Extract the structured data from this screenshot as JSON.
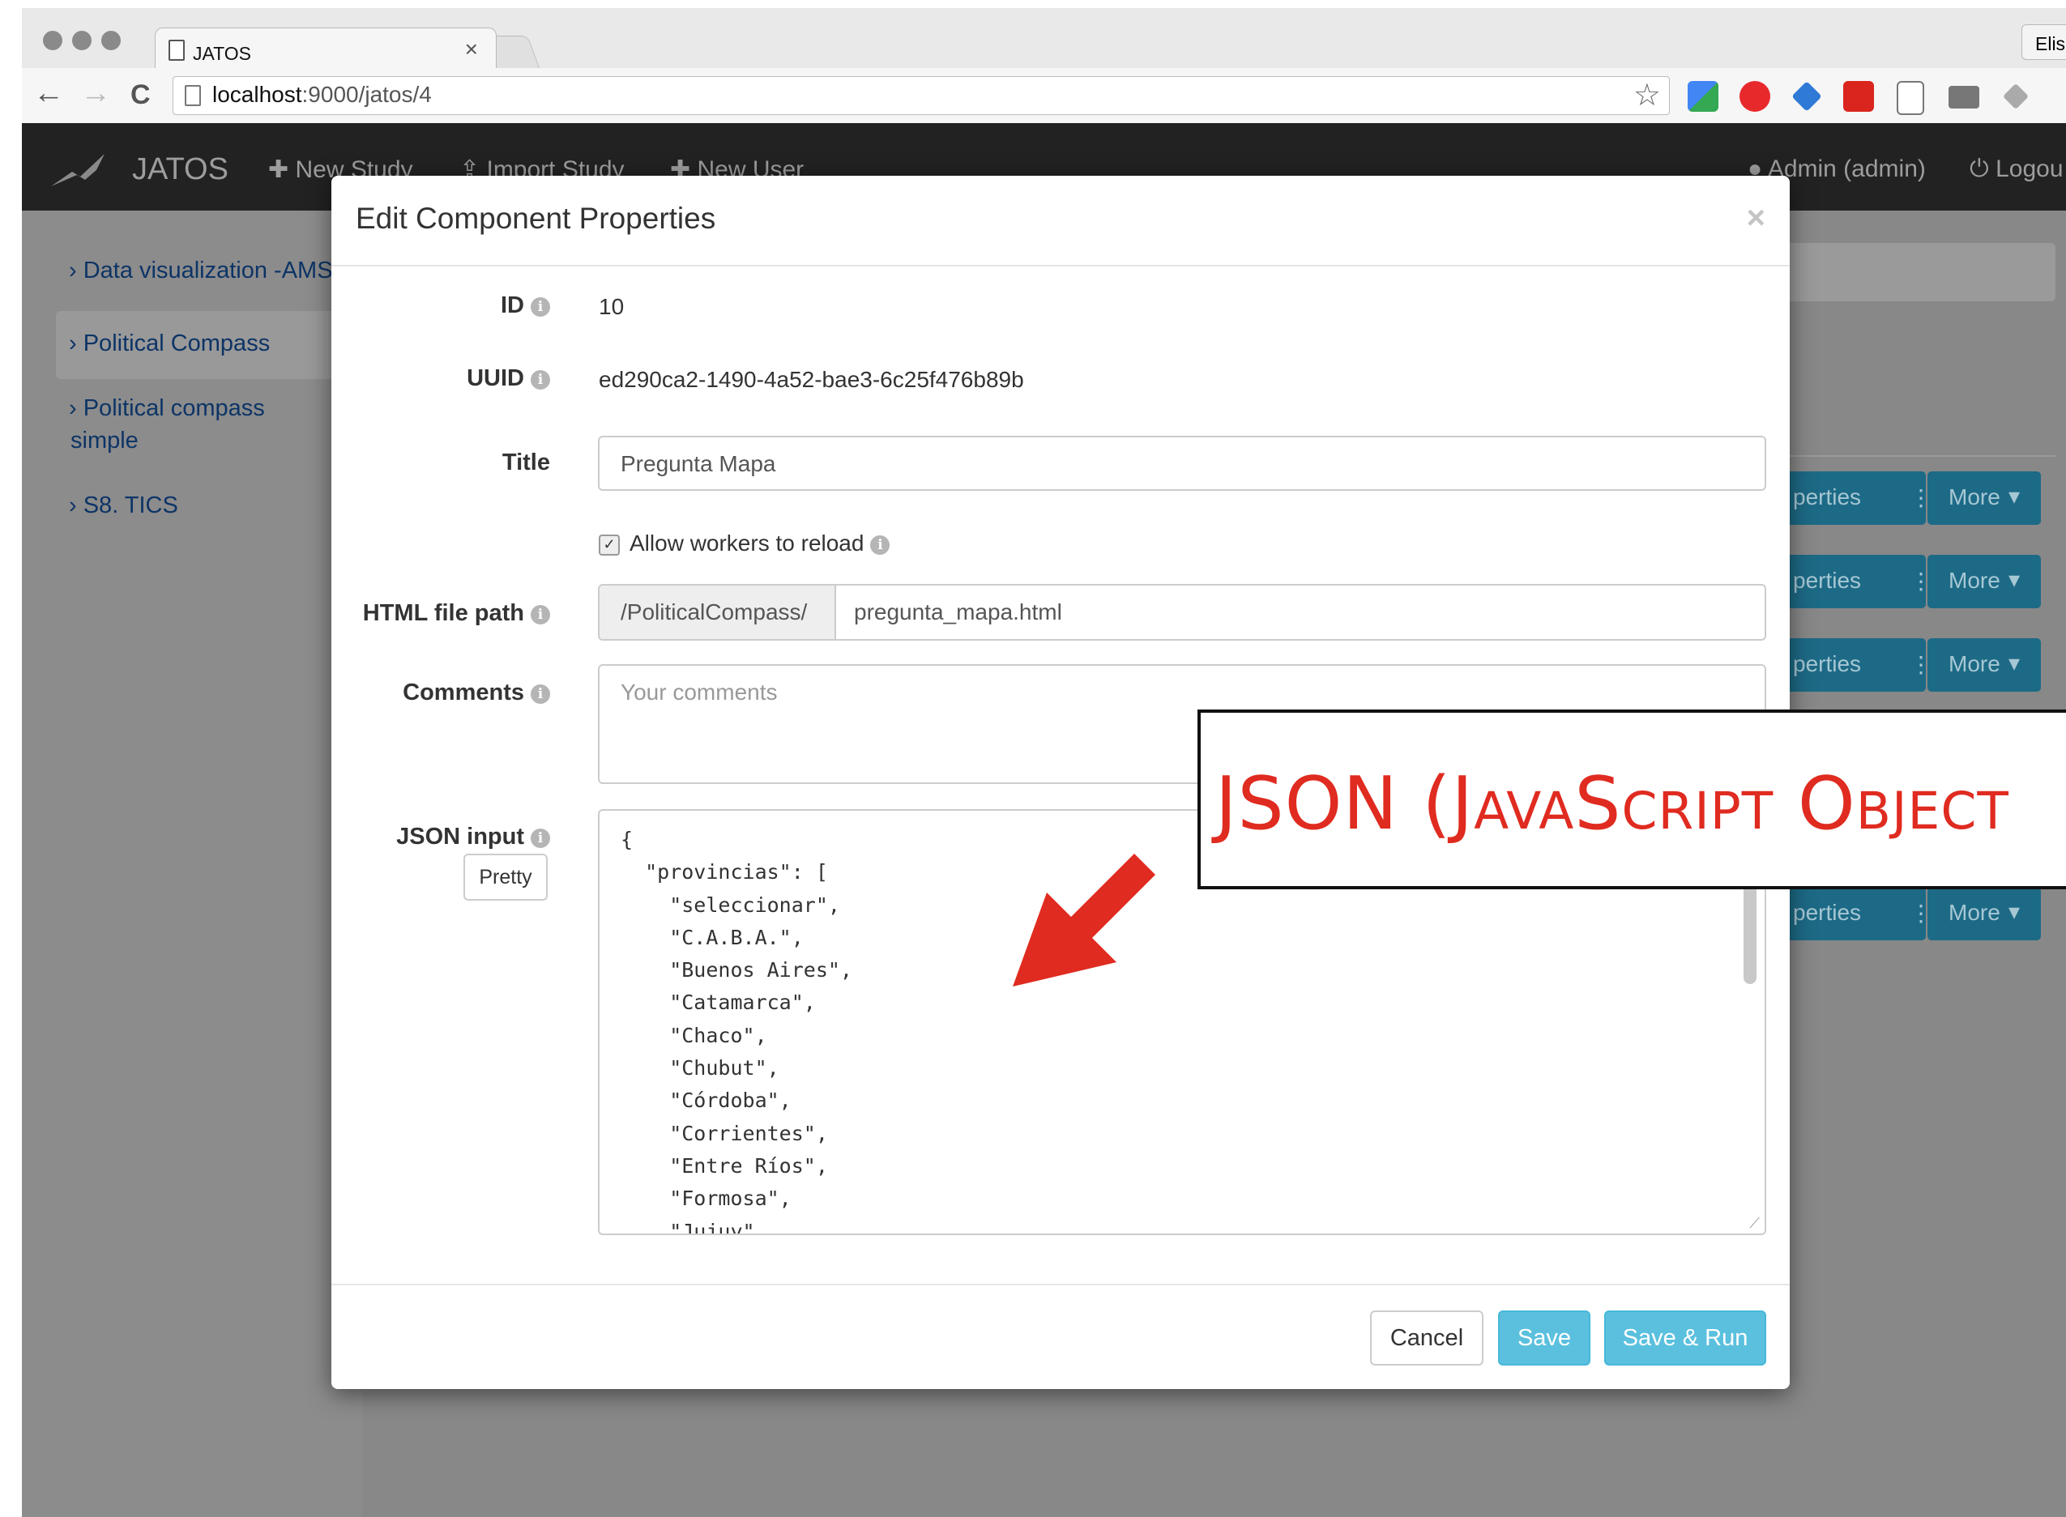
{
  "browser": {
    "tab_title": "JATOS",
    "tab_close": "×",
    "profile": "Elis",
    "url_host": "localhost",
    "url_path": ":9000/jatos/4",
    "nav_back": "←",
    "nav_forward": "→",
    "nav_reload": "C",
    "star": "☆"
  },
  "navbar": {
    "brand": "JATOS",
    "new_study": "New Study",
    "import_study": "Import Study",
    "new_user": "New User",
    "user": "Admin (admin)",
    "logout": "Logou"
  },
  "sidebar": {
    "items": [
      {
        "label": "Data visualization -AMS"
      },
      {
        "label": "Political Compass"
      },
      {
        "label": "Political compass"
      },
      {
        "label": "simple"
      },
      {
        "label": "S8. TICS"
      }
    ]
  },
  "background_rows": {
    "properties_label": "perties",
    "more_label": "More"
  },
  "modal": {
    "title": "Edit Component Properties",
    "close": "×",
    "id_label": "ID",
    "id_value": "10",
    "uuid_label": "UUID",
    "uuid_value": "ed290ca2-1490-4a52-bae3-6c25f476b89b",
    "title_label": "Title",
    "title_value": "Pregunta Mapa",
    "reload_label": "Allow workers to reload",
    "reload_checked": true,
    "html_path_label": "HTML file path",
    "html_path_prefix": "/PoliticalCompass/",
    "html_path_value": "pregunta_mapa.html",
    "comments_label": "Comments",
    "comments_placeholder": "Your comments",
    "json_label": "JSON input",
    "pretty_button": "Pretty",
    "json_text": "{\n  \"provincias\": [\n    \"seleccionar\",\n    \"C.A.B.A.\",\n    \"Buenos Aires\",\n    \"Catamarca\",\n    \"Chaco\",\n    \"Chubut\",\n    \"Córdoba\",\n    \"Corrientes\",\n    \"Entre Ríos\",\n    \"Formosa\",\n    \"Jujuy\",",
    "cancel_button": "Cancel",
    "save_button": "Save",
    "save_run_button": "Save & Run"
  },
  "callout": {
    "text": "JSON (JavaScript Object"
  },
  "colors": {
    "navbar": "#222222",
    "primary_button": "#5bc0de",
    "callout_text": "#e02b20",
    "link": "#0d3466"
  }
}
